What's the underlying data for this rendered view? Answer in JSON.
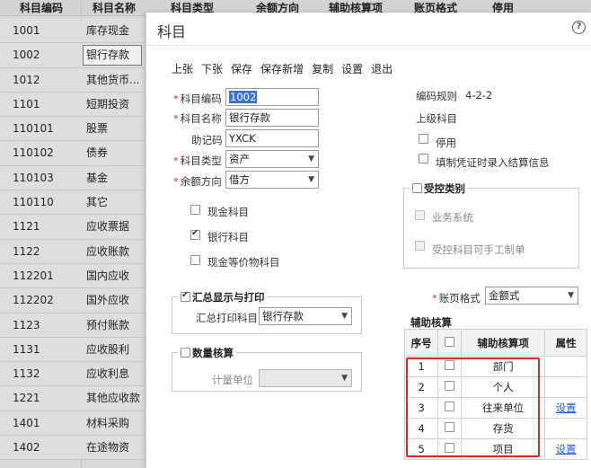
{
  "background": {
    "columns": [
      "科目编码",
      "科目名称",
      "科目类型",
      "余额方向",
      "辅助核算项",
      "账页格式",
      "停用"
    ],
    "rows": [
      {
        "code": "1001",
        "name": "库存现金"
      },
      {
        "code": "1002",
        "name": "银行存款"
      },
      {
        "code": "1012",
        "name": "其他货币..."
      },
      {
        "code": "1101",
        "name": "短期投资"
      },
      {
        "code": "110101",
        "name": "股票"
      },
      {
        "code": "110102",
        "name": "债券"
      },
      {
        "code": "110103",
        "name": "基金"
      },
      {
        "code": "110110",
        "name": "其它"
      },
      {
        "code": "1121",
        "name": "应收票据"
      },
      {
        "code": "1122",
        "name": "应收账款"
      },
      {
        "code": "112201",
        "name": "国内应收"
      },
      {
        "code": "112202",
        "name": "国外应收"
      },
      {
        "code": "1123",
        "name": "预付账款"
      },
      {
        "code": "1131",
        "name": "应收股利"
      },
      {
        "code": "1132",
        "name": "应收利息"
      },
      {
        "code": "1221",
        "name": "其他应收款"
      },
      {
        "code": "1401",
        "name": "材料采购"
      },
      {
        "code": "1402",
        "name": "在途物资"
      }
    ]
  },
  "dialog": {
    "title": "科目",
    "help_icon": "question-circle-icon",
    "toolbar": [
      "上张",
      "下张",
      "保存",
      "保存新增",
      "复制",
      "设置",
      "退出"
    ],
    "form": {
      "code_label": "科目编码",
      "code_value": "1002",
      "name_label": "科目名称",
      "name_value": "银行存款",
      "mnemonic_label": "助记码",
      "mnemonic_value": "YXCK",
      "type_label": "科目类型",
      "type_value": "资产",
      "direction_label": "余额方向",
      "direction_value": "借方",
      "cash_label": "现金科目",
      "bank_label": "银行科目",
      "cash_equiv_label": "现金等价物科目"
    },
    "right": {
      "rule_label": "编码规则",
      "rule_value": "4-2-2",
      "parent_label": "上级科目",
      "disable_label": "停用",
      "settlement_label": "填制凭证时录入结算信息"
    },
    "controlled": {
      "title": "受控类别",
      "business_label": "业务系统",
      "manual_label": "受控科目可手工制单"
    },
    "summary": {
      "title": "汇总显示与打印",
      "print_label": "汇总打印科目",
      "print_value": "银行存款"
    },
    "quantity": {
      "title": "数量核算",
      "unit_label": "计量单位"
    },
    "page_format": {
      "label": "账页格式",
      "value": "金额式"
    },
    "aux": {
      "title": "辅助核算",
      "headers": {
        "seq": "序号",
        "item": "辅助核算项",
        "attr": "属性"
      },
      "rows": [
        {
          "seq": "1",
          "item": "部门",
          "attr": ""
        },
        {
          "seq": "2",
          "item": "个人",
          "attr": ""
        },
        {
          "seq": "3",
          "item": "往来单位",
          "attr": "设置"
        },
        {
          "seq": "4",
          "item": "存货",
          "attr": ""
        },
        {
          "seq": "5",
          "item": "项目",
          "attr": "设置"
        }
      ]
    }
  }
}
